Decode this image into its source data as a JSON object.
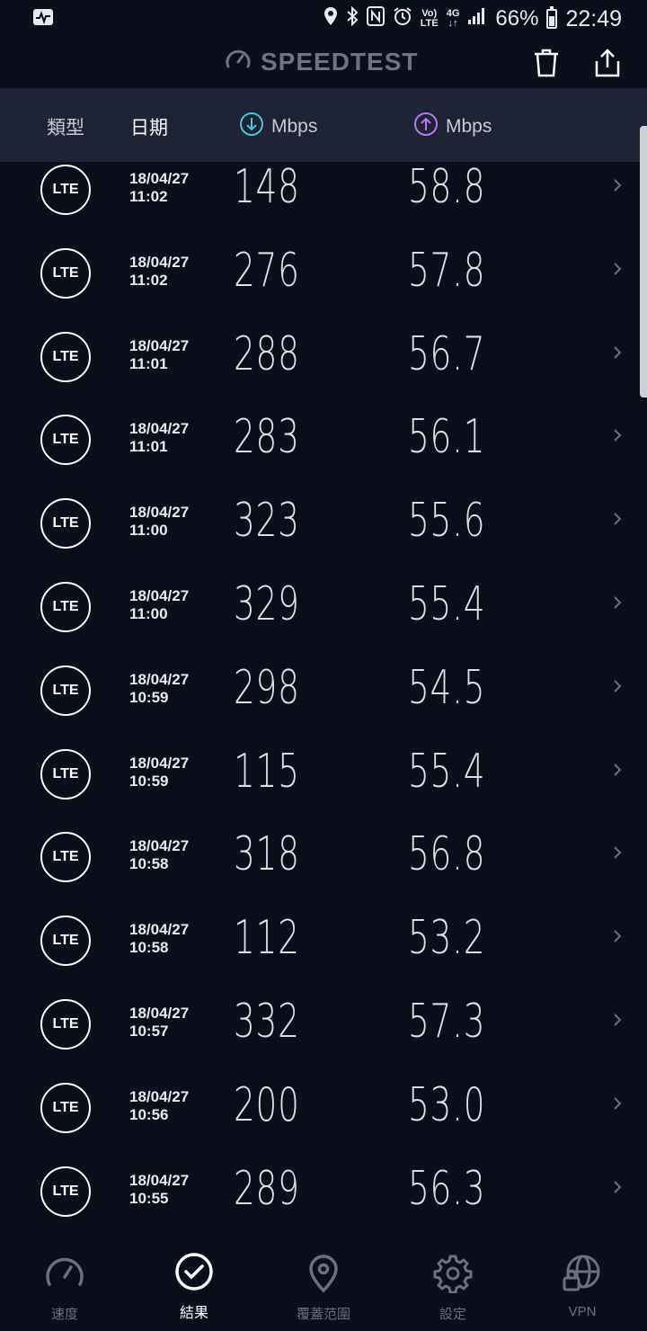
{
  "status_bar": {
    "volte_top": "Vo)",
    "volte_bottom": "LTE",
    "network_top": "4G",
    "network_bottom": "↓↑",
    "battery": "66%",
    "time": "22:49"
  },
  "header": {
    "brand": "SPEEDTEST",
    "delete_icon": "trash-icon",
    "share_icon": "share-icon"
  },
  "columns": {
    "type": "類型",
    "date": "日期",
    "download_unit": "Mbps",
    "upload_unit": "Mbps"
  },
  "results": [
    {
      "type": "LTE",
      "date": "18/04/27",
      "time": "11:02",
      "download": "148",
      "upload": "58.8"
    },
    {
      "type": "LTE",
      "date": "18/04/27",
      "time": "11:02",
      "download": "276",
      "upload": "57.8"
    },
    {
      "type": "LTE",
      "date": "18/04/27",
      "time": "11:01",
      "download": "288",
      "upload": "56.7"
    },
    {
      "type": "LTE",
      "date": "18/04/27",
      "time": "11:01",
      "download": "283",
      "upload": "56.1"
    },
    {
      "type": "LTE",
      "date": "18/04/27",
      "time": "11:00",
      "download": "323",
      "upload": "55.6"
    },
    {
      "type": "LTE",
      "date": "18/04/27",
      "time": "11:00",
      "download": "329",
      "upload": "55.4"
    },
    {
      "type": "LTE",
      "date": "18/04/27",
      "time": "10:59",
      "download": "298",
      "upload": "54.5"
    },
    {
      "type": "LTE",
      "date": "18/04/27",
      "time": "10:59",
      "download": "115",
      "upload": "55.4"
    },
    {
      "type": "LTE",
      "date": "18/04/27",
      "time": "10:58",
      "download": "318",
      "upload": "56.8"
    },
    {
      "type": "LTE",
      "date": "18/04/27",
      "time": "10:58",
      "download": "112",
      "upload": "53.2"
    },
    {
      "type": "LTE",
      "date": "18/04/27",
      "time": "10:57",
      "download": "332",
      "upload": "57.3"
    },
    {
      "type": "LTE",
      "date": "18/04/27",
      "time": "10:56",
      "download": "200",
      "upload": "53.0"
    },
    {
      "type": "LTE",
      "date": "18/04/27",
      "time": "10:55",
      "download": "289",
      "upload": "56.3"
    }
  ],
  "nav": {
    "speed": "速度",
    "results": "結果",
    "coverage": "覆蓋范圍",
    "settings": "設定",
    "vpn": "VPN"
  },
  "colors": {
    "background": "#0b0e1b",
    "header_band": "#1f2336",
    "download_accent": "#4fc3d7",
    "upload_accent": "#b57be8"
  }
}
